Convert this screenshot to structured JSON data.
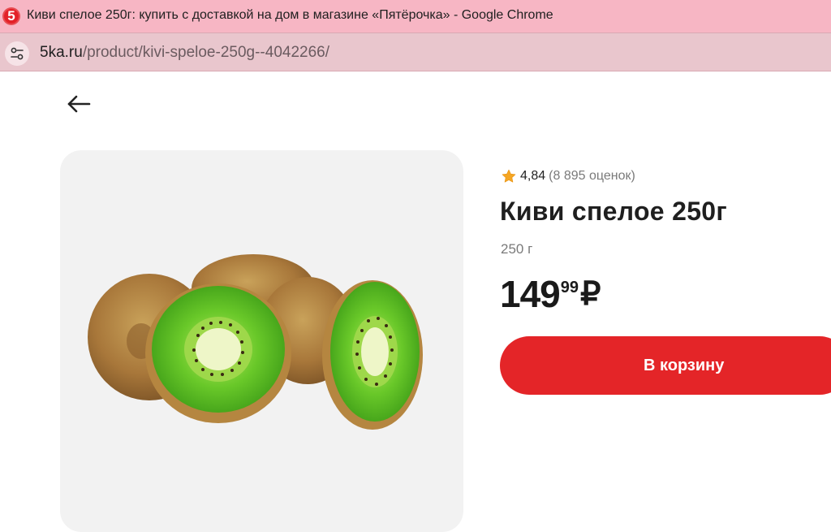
{
  "browser": {
    "window_title": "Киви спелое 250г: купить с доставкой на дом в магазине «Пятёрочка» - Google Chrome",
    "favicon_text": "5",
    "url_host": "5ka.ru",
    "url_path": "/product/kivi-speloe-250g--4042266/"
  },
  "product": {
    "rating_value": "4,84",
    "rating_count": "(8 895 оценок)",
    "title": "Киви спелое 250г",
    "weight": "250 г",
    "price_rub": "149",
    "price_kop": "99",
    "currency": "₽",
    "add_to_cart_label": "В корзину",
    "image_subject": "kiwi-fruit-image"
  },
  "colors": {
    "accent": "#e42528",
    "star": "#f5a623"
  },
  "icons": {
    "back": "arrow-left-icon",
    "site_info": "tune-icon",
    "rating": "star-icon"
  }
}
